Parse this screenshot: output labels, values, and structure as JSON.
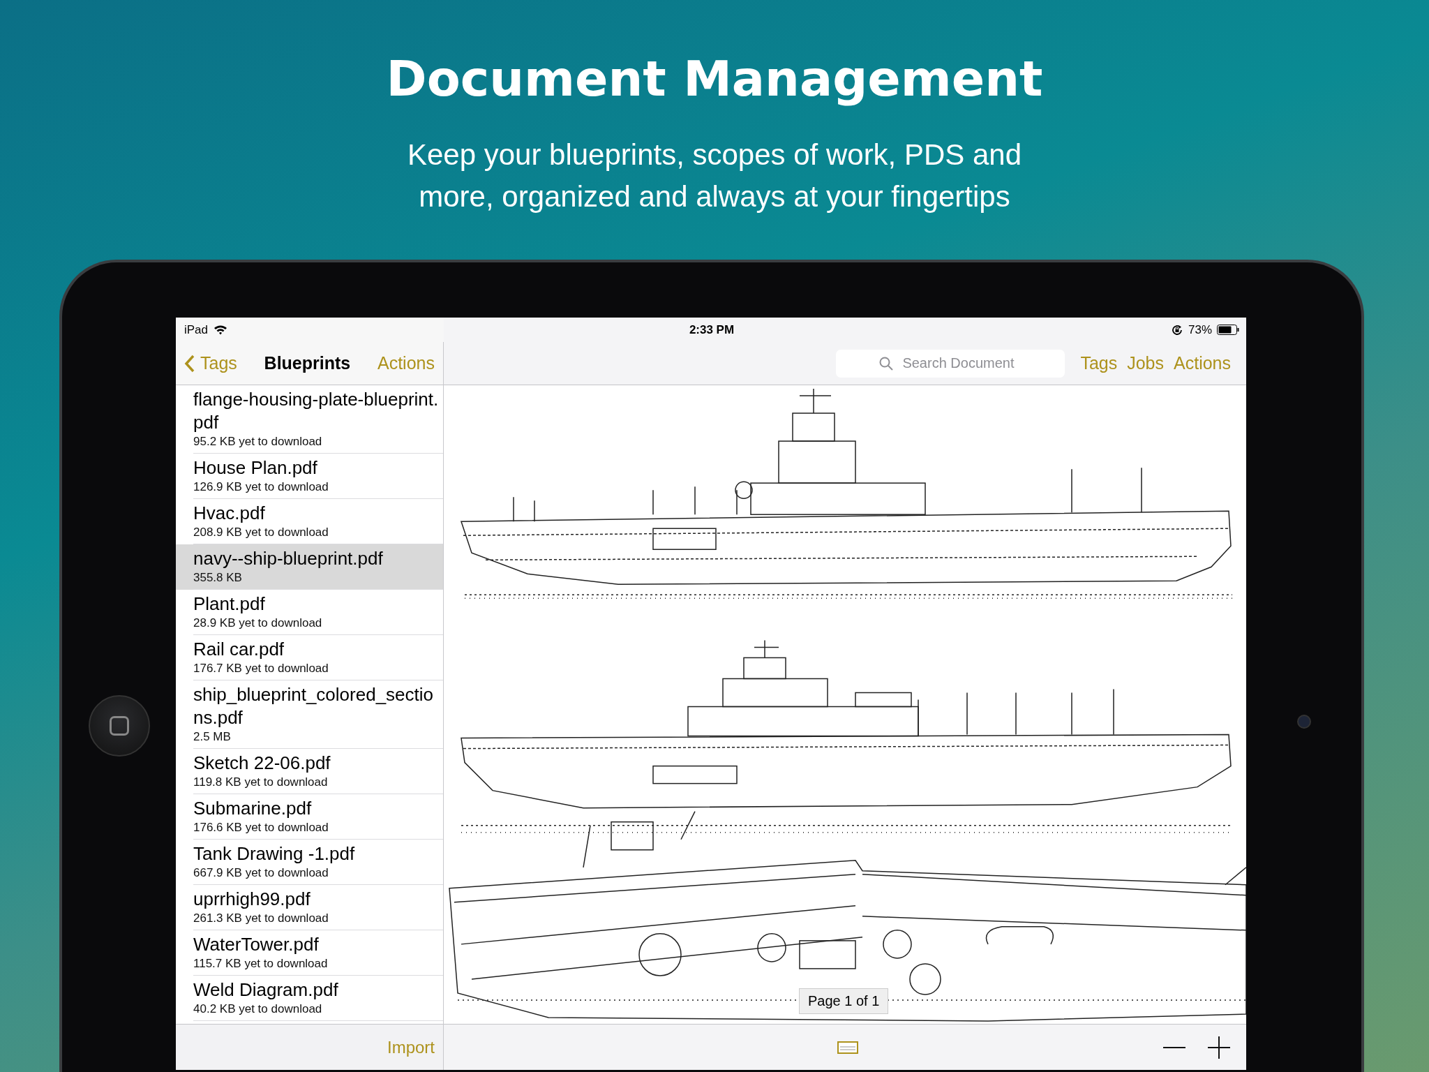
{
  "headline": "Document Management",
  "subtitle": "Keep your blueprints, scopes of work, PDS and more, organized and always at your fingertips",
  "status_bar": {
    "device": "iPad",
    "time": "2:33 PM",
    "battery": "73%"
  },
  "sidebar": {
    "back": "Tags",
    "title": "Blueprints",
    "action": "Actions",
    "import": "Import",
    "files": [
      {
        "name": "flange-housing-plate-blueprint.pdf",
        "size": "95.2 KB yet to download",
        "selected": false
      },
      {
        "name": "House Plan.pdf",
        "size": "126.9 KB yet to download",
        "selected": false
      },
      {
        "name": "Hvac.pdf",
        "size": "208.9 KB yet to download",
        "selected": false
      },
      {
        "name": "navy--ship-blueprint.pdf",
        "size": "355.8 KB",
        "selected": true
      },
      {
        "name": "Plant.pdf",
        "size": "28.9 KB yet to download",
        "selected": false
      },
      {
        "name": "Rail car.pdf",
        "size": "176.7 KB yet to download",
        "selected": false
      },
      {
        "name": "ship_blueprint_colored_sections.pdf",
        "size": "2.5 MB",
        "selected": false
      },
      {
        "name": "Sketch 22-06.pdf",
        "size": "119.8 KB yet to download",
        "selected": false
      },
      {
        "name": "Submarine.pdf",
        "size": "176.6 KB yet to download",
        "selected": false
      },
      {
        "name": "Tank Drawing -1.pdf",
        "size": "667.9 KB yet to download",
        "selected": false
      },
      {
        "name": "uprrhigh99.pdf",
        "size": "261.3 KB yet to download",
        "selected": false
      },
      {
        "name": "WaterTower.pdf",
        "size": "115.7 KB yet to download",
        "selected": false
      },
      {
        "name": "Weld Diagram.pdf",
        "size": "40.2 KB yet to download",
        "selected": false
      }
    ]
  },
  "viewer": {
    "search": {
      "placeholder": "Search Document"
    },
    "nav_buttons": [
      "Tags",
      "Jobs",
      "Actions"
    ],
    "page_indicator": "Page 1 of 1"
  }
}
